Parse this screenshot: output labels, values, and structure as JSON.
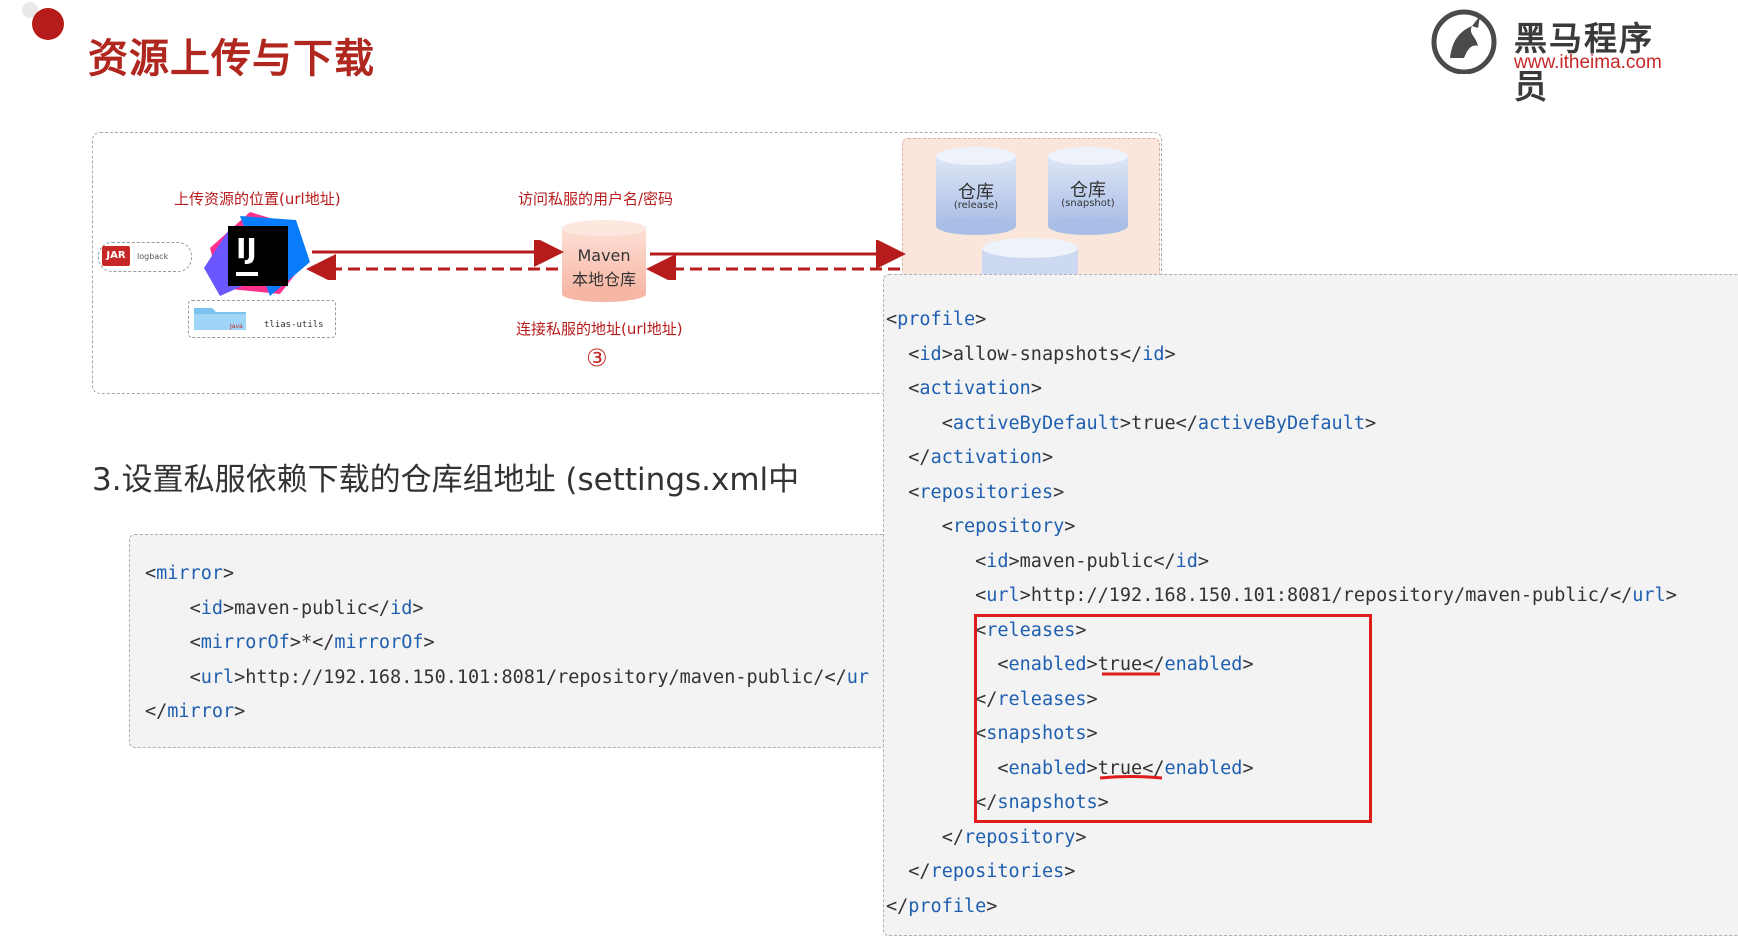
{
  "header": {
    "title": "资源上传与下载",
    "logo_name": "黑马程序员",
    "logo_url": "www.itheima.com"
  },
  "diagram": {
    "upload_location_label": "上传资源的位置(url地址)",
    "credentials_label": "访问私服的用户名/密码",
    "connect_label": "连接私服的地址(url地址)",
    "step_marker": "③",
    "jar_icon_text": "JAR",
    "jar_label": "logback",
    "ide_logo_text": "IJ",
    "folder_label": "tlias-utils",
    "folder_icon_text": "Java",
    "maven_title": "Maven",
    "maven_subtitle": "本地仓库",
    "repo_release_title": "仓库",
    "repo_release_sub": "(release)",
    "repo_snapshot_title": "仓库",
    "repo_snapshot_sub": "(snapshot)"
  },
  "step3_heading": "3.设置私服依赖下载的仓库组地址 (settings.xml中",
  "mirror_code": {
    "mirror_open": "mirror",
    "id_tag": "id",
    "id_value": "maven-public",
    "mirrorof_tag": "mirrorOf",
    "mirrorof_value": "*",
    "url_tag": "url",
    "url_value": "http://192.168.150.101:8081/repository/maven-public/",
    "url_close_partial": "ur"
  },
  "profile_code": {
    "profile_tag": "profile",
    "id_tag": "id",
    "id_value": "allow-snapshots",
    "activation_tag": "activation",
    "active_tag": "activeByDefault",
    "active_value": "true",
    "repositories_tag": "repositories",
    "repository_tag": "repository",
    "repo_id_value": "maven-public",
    "url_tag": "url",
    "url_value": "http://192.168.150.101:8081/repository/maven-public/",
    "releases_tag": "releases",
    "enabled_tag": "enabled",
    "releases_enabled": "true",
    "snapshots_tag": "snapshots",
    "snapshots_enabled": "true"
  },
  "colors": {
    "title_red": "#b0271f",
    "tag_blue": "#1f5fb0",
    "highlight_red": "#e01b1b"
  }
}
